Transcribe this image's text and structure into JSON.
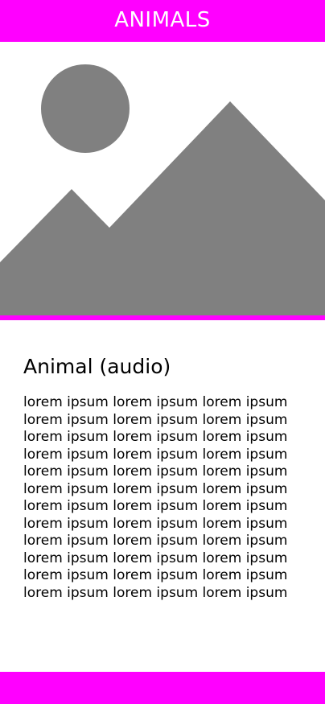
{
  "header": {
    "title": "ANIMALS"
  },
  "hero": {
    "icon": "image-placeholder-icon"
  },
  "article": {
    "title": "Animal (audio)",
    "lines": [
      "lorem ipsum lorem ipsum lorem ipsum",
      "lorem ipsum lorem ipsum lorem ipsum",
      "lorem ipsum lorem ipsum lorem ipsum",
      "lorem ipsum lorem ipsum lorem ipsum",
      "lorem ipsum lorem ipsum lorem ipsum",
      "lorem ipsum lorem ipsum lorem ipsum",
      "lorem ipsum lorem ipsum lorem ipsum",
      "lorem ipsum lorem ipsum lorem ipsum",
      "lorem ipsum lorem ipsum lorem ipsum",
      "lorem ipsum lorem ipsum lorem ipsum",
      "lorem ipsum lorem ipsum lorem ipsum",
      "lorem ipsum lorem ipsum lorem ipsum"
    ]
  },
  "colors": {
    "accent": "#ff00ff",
    "placeholder": "#808080",
    "text": "#000000",
    "background": "#ffffff"
  }
}
